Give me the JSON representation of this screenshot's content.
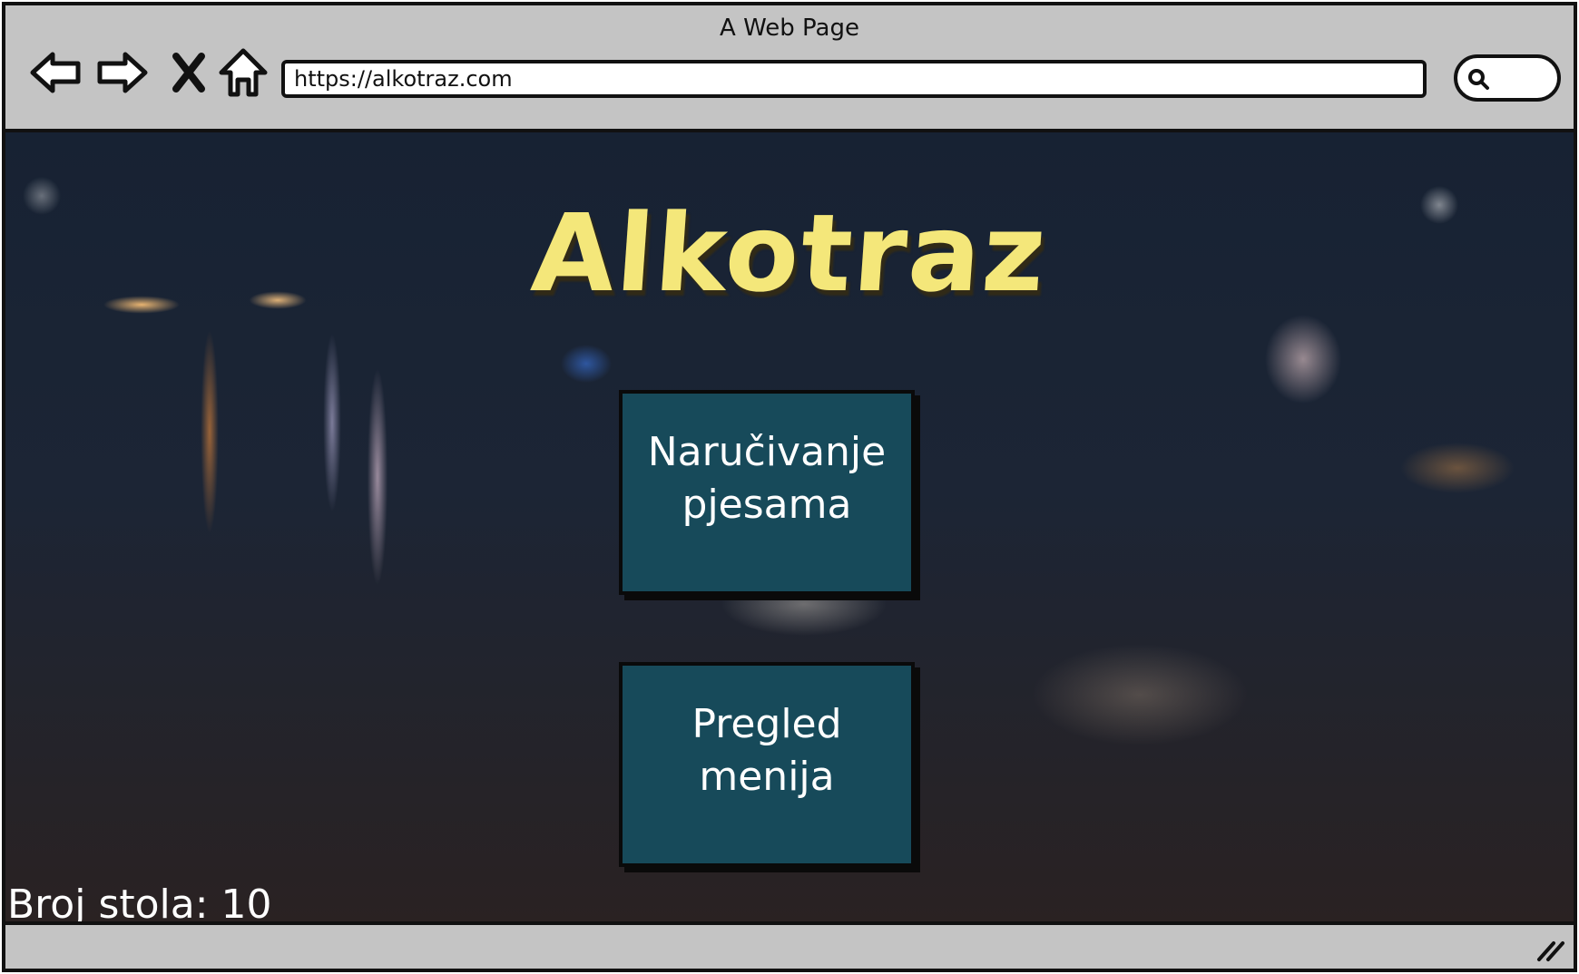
{
  "browser": {
    "title": "A Web Page",
    "url": "https://alkotraz.com",
    "nav_icons": [
      "back-arrow-icon",
      "forward-arrow-icon",
      "close-icon",
      "home-icon"
    ],
    "search_icon": "search-icon"
  },
  "page": {
    "logo": "Alkotraz",
    "buttons": [
      {
        "line1": "Naručivanje",
        "line2": "pjesama"
      },
      {
        "line1": "Pregled",
        "line2": "menija"
      }
    ],
    "table_label": "Broj stola: 10"
  },
  "colors": {
    "logo": "#f4e77a",
    "tile_bg": "#174a5a",
    "chrome": "#c4c4c4"
  }
}
